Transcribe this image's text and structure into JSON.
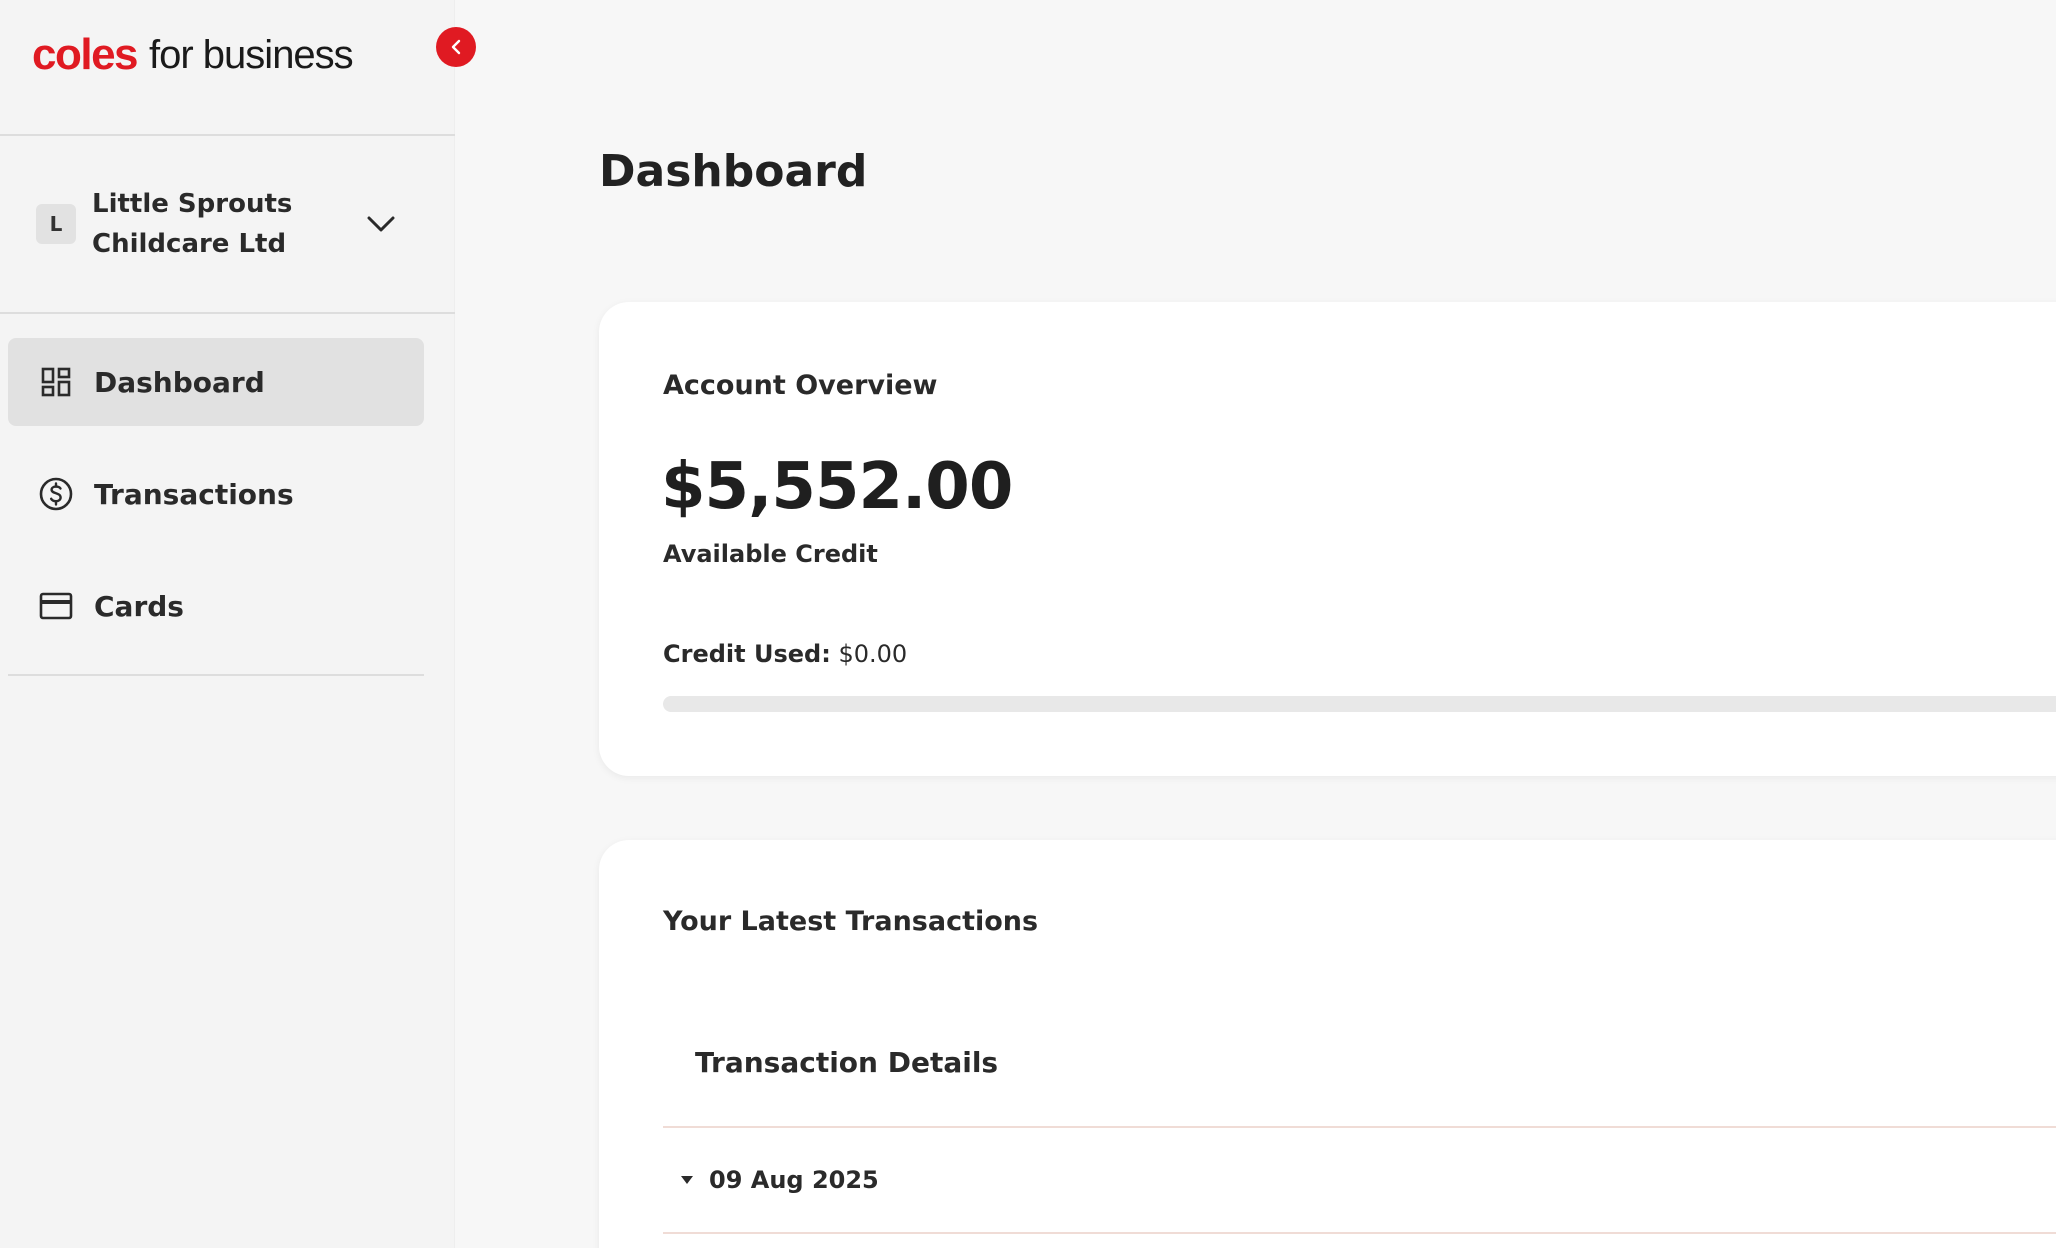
{
  "brand": {
    "logo_primary": "coles",
    "logo_secondary": "for business",
    "accent_color": "#e01a22"
  },
  "sidebar": {
    "collapse_icon": "chevron-left-icon",
    "account": {
      "initial": "L",
      "name": "Little Sprouts Childcare Ltd",
      "dropdown_icon": "chevron-down-icon"
    },
    "items": [
      {
        "label": "Dashboard",
        "icon": "dashboard-icon",
        "active": true
      },
      {
        "label": "Transactions",
        "icon": "dollar-circle-icon",
        "active": false
      },
      {
        "label": "Cards",
        "icon": "credit-card-icon",
        "active": false
      }
    ]
  },
  "main": {
    "title": "Dashboard",
    "overview": {
      "title": "Account Overview",
      "available_amount": "$5,552.00",
      "available_label": "Available Credit",
      "credit_used_label": "Credit Used:",
      "credit_used_value": "$0.00",
      "credit_used_fraction": 0
    },
    "latest": {
      "title": "Your Latest Transactions",
      "table_header": "Transaction Details",
      "groups": [
        {
          "date": "09 Aug 2025",
          "expanded": true
        }
      ]
    }
  }
}
